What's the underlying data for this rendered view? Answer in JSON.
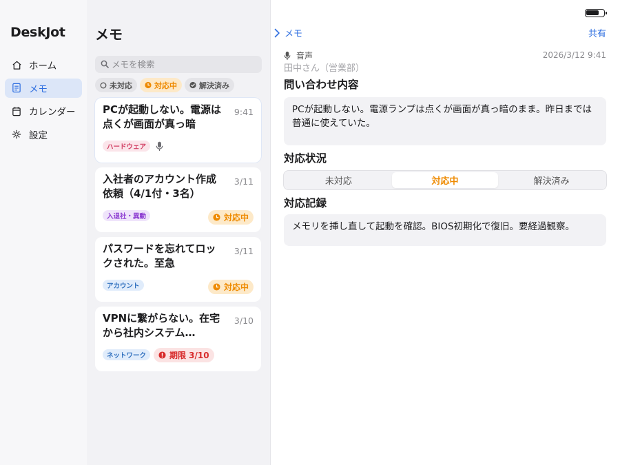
{
  "sidebar": {
    "app_title": "DeskJot",
    "items": [
      {
        "label": "ホーム",
        "icon": "home-icon"
      },
      {
        "label": "メモ",
        "icon": "notes-icon",
        "active": true
      },
      {
        "label": "カレンダー",
        "icon": "calendar-icon"
      },
      {
        "label": "設定",
        "icon": "gear-icon"
      }
    ]
  },
  "list": {
    "title": "メモ",
    "search_placeholder": "メモを検索",
    "filters": [
      {
        "label": "未対応",
        "icon": "circle-outline-icon"
      },
      {
        "label": "対応中",
        "icon": "clock-icon",
        "active": true
      },
      {
        "label": "解決済み",
        "icon": "check-circle-icon"
      }
    ],
    "cards": [
      {
        "title": "PCが起動しない。電源は点くが画面が真っ暗",
        "date": "9:41",
        "tag": "ハードウェア",
        "has_voice": true
      },
      {
        "title": "入社者のアカウント作成依頼（4/1付・3名）",
        "date": "3/11",
        "tag": "入退社・異動",
        "status": "対応中"
      },
      {
        "title": "パスワードを忘れてロックされた。至急",
        "date": "3/11",
        "tag": "アカウント",
        "status": "対応中"
      },
      {
        "title": "VPNに繋がらない。在宅から社内システム…",
        "date": "3/10",
        "tag": "ネットワーク",
        "deadline": "期限 3/10"
      }
    ]
  },
  "detail": {
    "back_label": "メモ",
    "share_label": "共有",
    "source_label": "音声",
    "timestamp": "2026/3/12 9:41",
    "customer": "田中さん（営業部）",
    "inquiry_title": "問い合わせ内容",
    "inquiry_text": "PCが起動しない。電源ランプは点くが画面が真っ暗のまま。昨日までは普通に使えていた。",
    "status_title": "対応状況",
    "status_options": [
      "未対応",
      "対応中",
      "解決済み"
    ],
    "status_selected": "対応中",
    "log_title": "対応記録",
    "log_text": "メモリを挿し直して起動を確認。BIOS初期化で復旧。要経過観察。"
  },
  "colors": {
    "accent": "#2f6fe0",
    "in_progress": "#ee8a00",
    "overdue": "#d82c2c"
  }
}
